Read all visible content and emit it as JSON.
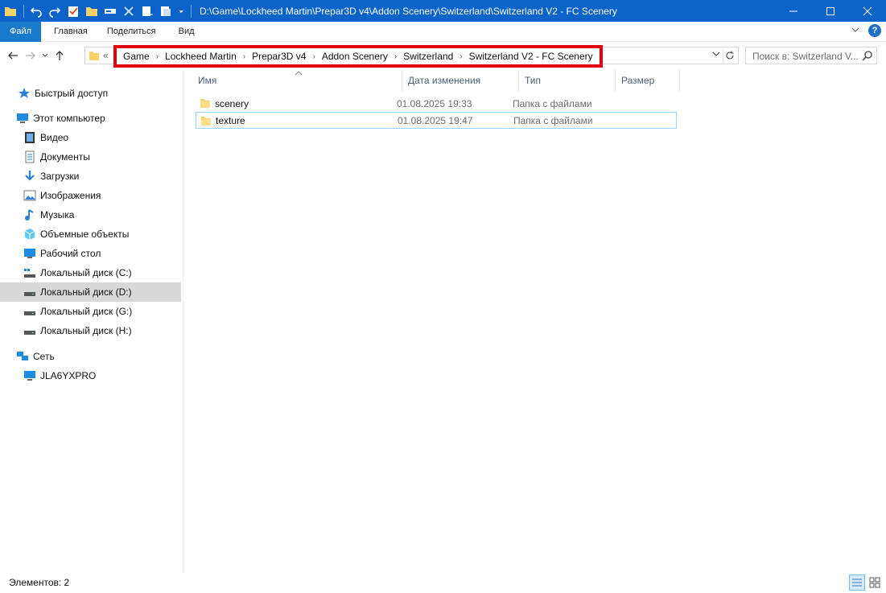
{
  "window": {
    "title": "D:\\Game\\Lockheed Martin\\Prepar3D v4\\Addon Scenery\\Switzerland\\Switzerland V2 - FC Scenery",
    "accent": "#0a63c9"
  },
  "ribbon": {
    "file": "Файл",
    "tabs": [
      "Главная",
      "Поделиться",
      "Вид"
    ],
    "help": "?"
  },
  "address": {
    "overflow": "«",
    "crumbs": [
      "Game",
      "Lockheed Martin",
      "Prepar3D v4",
      "Addon Scenery",
      "Switzerland",
      "Switzerland V2 - FC Scenery"
    ],
    "highlight_color": "#e0000f"
  },
  "search": {
    "placeholder": "Поиск в: Switzerland V..."
  },
  "sidebar": {
    "quick_access": "Быстрый доступ",
    "this_pc": "Этот компьютер",
    "items": [
      "Видео",
      "Документы",
      "Загрузки",
      "Изображения",
      "Музыка",
      "Объемные объекты",
      "Рабочий стол",
      "Локальный диск (C:)",
      "Локальный диск (D:)",
      "Локальный диск (G:)",
      "Локальный диск (H:)"
    ],
    "network": "Сеть",
    "network_items": [
      "JLA6YXPRO"
    ],
    "selected": "Локальный диск (D:)"
  },
  "columns": {
    "name": "Имя",
    "date": "Дата изменения",
    "type": "Тип",
    "size": "Размер"
  },
  "files": [
    {
      "name": "scenery",
      "date": "01.08.2025 19:33",
      "type": "Папка с файлами"
    },
    {
      "name": "texture",
      "date": "01.08.2025 19:47",
      "type": "Папка с файлами"
    }
  ],
  "status": {
    "count": "Элементов: 2"
  }
}
